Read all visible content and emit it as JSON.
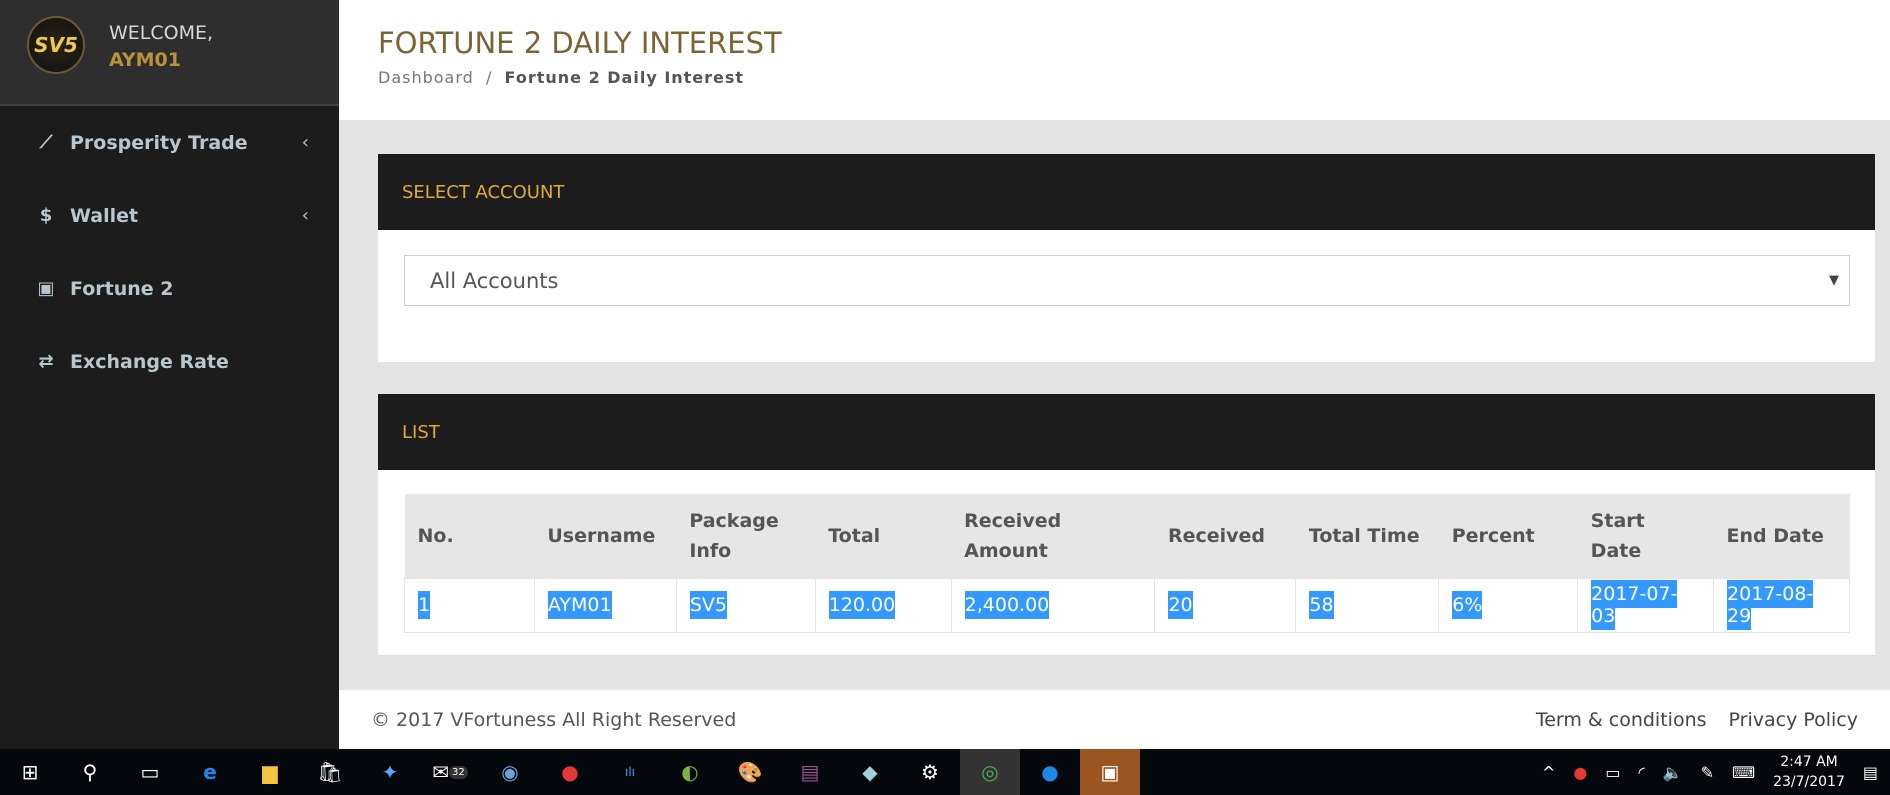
{
  "sidebar": {
    "logo_text": "SV5",
    "welcome": "WELCOME,",
    "username": "AYM01",
    "items": [
      {
        "label": "Prosperity Trade",
        "icon": "line-chart-icon",
        "glyph": "📈"
      },
      {
        "label": "Wallet",
        "icon": "dollar-icon",
        "glyph": "$"
      },
      {
        "label": "Fortune 2",
        "icon": "gift-icon",
        "glyph": "🎁"
      },
      {
        "label": "Exchange Rate",
        "icon": "exchange-icon",
        "glyph": "⇄"
      }
    ]
  },
  "header": {
    "title": "FORTUNE 2 DAILY INTEREST",
    "breadcrumb": {
      "home": "Dashboard",
      "sep": "/",
      "current": "Fortune 2 Daily Interest"
    }
  },
  "select_panel": {
    "title": "SELECT ACCOUNT",
    "selected": "All Accounts"
  },
  "list_panel": {
    "title": "LIST",
    "columns": [
      "No.",
      "Username",
      "Package Info",
      "Total",
      "Received Amount",
      "Received",
      "Total Time",
      "Percent",
      "Start Date",
      "End Date"
    ],
    "rows": [
      [
        "1",
        "AYM01",
        "SV5",
        "120.00",
        "2,400.00",
        "20",
        "58",
        "6%",
        "2017-07-03",
        "2017-08-29"
      ]
    ]
  },
  "footer": {
    "copyright": "© 2017 VFortuness All Right Reserved",
    "terms": "Term & conditions",
    "privacy": "Privacy Policy"
  },
  "taskbar": {
    "mail_badge": "32",
    "time": "2:47 AM",
    "date": "23/7/2017"
  },
  "colors": {
    "accent": "#e0a93c",
    "title": "#7b6434",
    "selection": "#3399ff"
  }
}
